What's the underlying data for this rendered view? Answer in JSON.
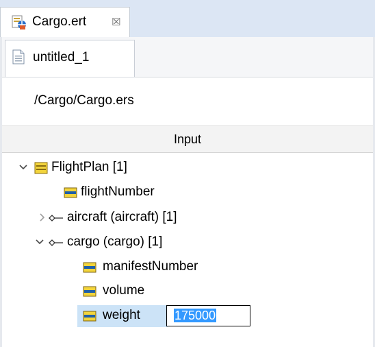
{
  "editor_tab": {
    "label": "Cargo.ert",
    "close_glyph": "☒",
    "icon": "mapping-file-icon"
  },
  "sub_tab": {
    "label": "untitled_1",
    "icon": "document-icon"
  },
  "source_path": "/Cargo/Cargo.ers",
  "column_header": "Input",
  "tree": {
    "flight_plan": {
      "label": "FlightPlan [1]",
      "expanded": true,
      "icon": "element-icon"
    },
    "flight_number": {
      "label": "flightNumber",
      "icon": "field-icon"
    },
    "aircraft": {
      "label": "aircraft (aircraft) [1]",
      "expanded": false,
      "icon": "reference-icon"
    },
    "cargo": {
      "label": "cargo (cargo) [1]",
      "expanded": true,
      "icon": "reference-icon"
    },
    "manifest_number": {
      "label": "manifestNumber",
      "icon": "field-icon"
    },
    "volume": {
      "label": "volume",
      "icon": "field-icon"
    },
    "weight": {
      "label": "weight",
      "icon": "field-icon",
      "selected": true,
      "value": "175000"
    }
  },
  "colors": {
    "tabbar_bg": "#dce6f4",
    "selection_bg": "#cce3f7",
    "text_selection": "#3399ff",
    "field_icon_yellow": "#f2d43c",
    "field_icon_blue": "#1f5fa8"
  }
}
